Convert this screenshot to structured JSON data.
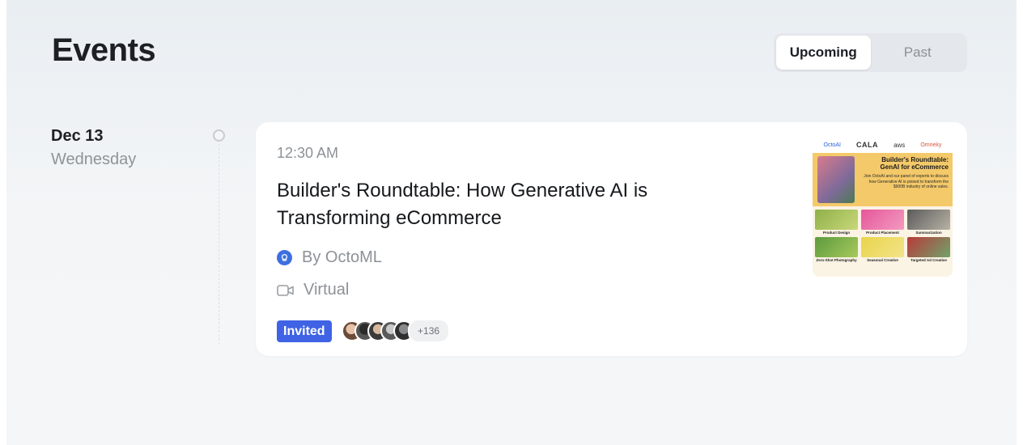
{
  "page": {
    "title": "Events"
  },
  "filter_toggle": {
    "options": [
      "Upcoming",
      "Past"
    ],
    "active": "Upcoming"
  },
  "events": [
    {
      "date": "Dec 13",
      "weekday": "Wednesday",
      "time": "12:30 AM",
      "title": "Builder's Roundtable: How Generative AI is Transforming eCommerce",
      "host": "By OctoML",
      "location": "Virtual",
      "status_badge": "Invited",
      "guest_count": "+136",
      "thumbnail": {
        "logos": [
          "OctoAI",
          "CALA",
          "aws",
          "Omneky"
        ],
        "heading_line1": "Builder's Roundtable:",
        "heading_line2": "GenAI for eCommerce",
        "subtext": "Join OctoAI and our panel of experts to discuss how Generative AI is poised to transform the $900B industry of online sales.",
        "tiles": [
          "Product Design",
          "Product Placement",
          "Summarization",
          "Zero-Shot Photography",
          "Seasonal Creative",
          "Targeted Ad Creative"
        ]
      }
    }
  ],
  "colors": {
    "accent": "#3f63e4",
    "host_icon": "#3d6fe0",
    "thumbnail_banner": "#f4c96a"
  },
  "icons": {
    "host": "octoml-logo-icon",
    "location": "video-camera-icon",
    "timeline": "timeline-dot-icon"
  }
}
